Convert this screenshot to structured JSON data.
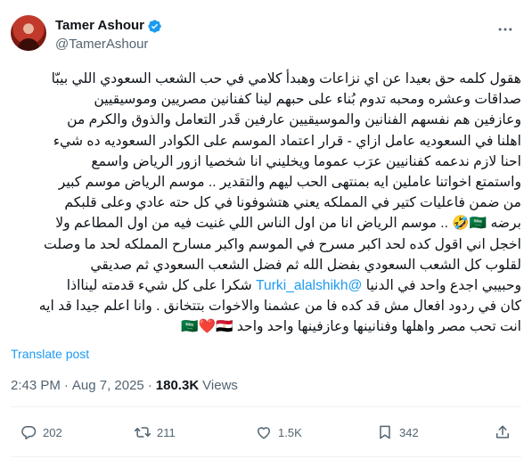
{
  "author": {
    "name": "Tamer Ashour",
    "handle": "@TamerAshour"
  },
  "body_lines": [
    {
      "text": "هقول كلمه حق بعيدا عن اي نزاعات وهبدأ كلامي في حب الشعب السعودي اللي بيبّا"
    },
    {
      "text": "صداقات وعشره ومحبه تدوم بُناء على حبهم لينا كفنانين مصريين وموسيقيين"
    },
    {
      "text": "وعازفين هم نفسهم الفنانين والموسيقيين  عارفين قَدر التعامل والذوق والكرم من"
    },
    {
      "text": "اهلنا في السعوديه عامل ازاي - قرار اعتماد الموسم على الكوادر السعوديه ده شيء"
    },
    {
      "text": "احنا لازم ندعمه كفنانيين عرَب عموما ويخليني انا شخصيا ازور الرياض واسمع"
    },
    {
      "text": "واستمتع اخواتنا عاملين ايه بمنتهى الحب ليهم والتقدير .. موسم الرياض موسم كبير"
    },
    {
      "text": "من ضمن فاعليات كتير في المملكه يعني هتشوفونا في كل حته عادي وعلى قلبكم"
    },
    {
      "text": "برضه 🇸🇦🤣 .. موسم الرياض انا من اول الناس اللي غنيت فيه من اول المطاعم ولا"
    },
    {
      "text": "اخجل اني اقول كده لحد اكبر مسرح في الموسم واكبر مسارح المملكه لحد ما وصلت"
    },
    {
      "text": "لقلوب كل الشعب السعودي بفضل الله ثم فضل الشعب السعودي ثم صديقي"
    },
    {
      "before": "وحبيبي اجدع واحد في الدنيا ",
      "mention": "@Turki_alalshikh",
      "after": " شكرا على كل شيء قدمته لينااذا"
    },
    {
      "text": "كان في ردود افعال مش قد كده فا من عشمنا والاخوات بتتخانق . وانا اعلم جيدا قد ايه"
    },
    {
      "text": "انت تحب مصر واهلها وفنانينها وعازفينها واحد واحد 🇸🇦❤️🇪🇬"
    }
  ],
  "translate_label": "Translate post",
  "meta": {
    "time": "2:43 PM",
    "separator": "·",
    "date": "Aug 7, 2025",
    "views_count": "180.3K",
    "views_label": "Views"
  },
  "actions": {
    "replies": "202",
    "reposts": "211",
    "likes": "1.5K",
    "bookmarks": "342"
  },
  "colors": {
    "accent": "#1d9bf0",
    "muted": "#536471",
    "divider": "#eff3f4"
  },
  "icons": [
    "verified-badge-icon",
    "more-options-icon",
    "reply-icon",
    "repost-icon",
    "like-icon",
    "bookmark-icon",
    "share-icon"
  ]
}
